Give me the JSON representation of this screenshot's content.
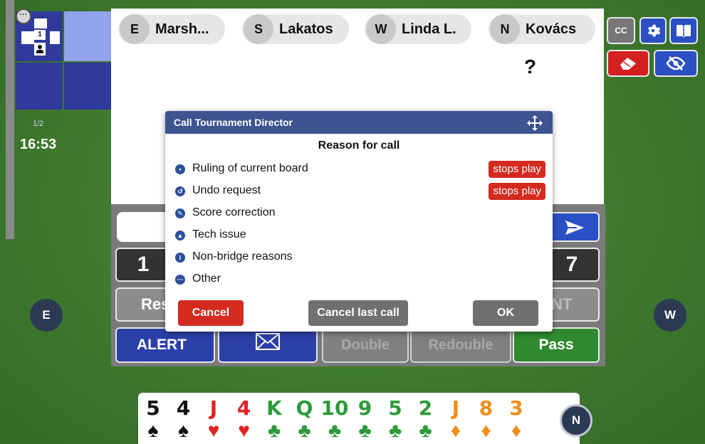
{
  "board_panel": {
    "board_number": "1",
    "round": "1/2",
    "timer": "16:53",
    "chat_icon": "chat-bubble-icon"
  },
  "players": [
    {
      "seat": "E",
      "name": "Marsh..."
    },
    {
      "seat": "S",
      "name": "Lakatos"
    },
    {
      "seat": "W",
      "name": "Linda L."
    },
    {
      "seat": "N",
      "name": "Kovács"
    }
  ],
  "auction_marker": "?",
  "toolbar": {
    "cc_label": "CC",
    "gear_icon": "gear-icon",
    "book_icon": "book-icon",
    "eraser_icon": "eraser-icon",
    "eye_icon": "eye-slash-icon"
  },
  "bidding_box": {
    "send_icon": "send-icon",
    "level_left": "1",
    "level_right": "7",
    "row_left_partial": "Res",
    "row_right_partial": "NT",
    "alert_label": "ALERT",
    "mail_icon": "envelope-icon",
    "double_label": "Double",
    "redouble_label": "Redouble",
    "pass_label": "Pass"
  },
  "side_seats": {
    "left": "E",
    "right": "W",
    "bottom": "N"
  },
  "dialog": {
    "title": "Call Tournament Director",
    "move_icon": "move-arrows-icon",
    "subtitle": "Reason for call",
    "reasons": [
      {
        "label": "Ruling of current board",
        "badge": "stops play",
        "icon": "ruling-icon"
      },
      {
        "label": "Undo request",
        "badge": "stops play",
        "icon": "undo-icon"
      },
      {
        "label": "Score correction",
        "badge": "",
        "icon": "pencil-icon"
      },
      {
        "label": "Tech issue",
        "badge": "",
        "icon": "warning-icon"
      },
      {
        "label": "Non-bridge reasons",
        "badge": "",
        "icon": "info-icon"
      },
      {
        "label": "Other",
        "badge": "",
        "icon": "ellipsis-icon"
      }
    ],
    "cancel_label": "Cancel",
    "cancel_last_label": "Cancel last call",
    "ok_label": "OK"
  },
  "hand": [
    {
      "rank": "5",
      "suit": "♠",
      "color": "#111111"
    },
    {
      "rank": "4",
      "suit": "♠",
      "color": "#111111"
    },
    {
      "rank": "J",
      "suit": "♥",
      "color": "#e02424"
    },
    {
      "rank": "4",
      "suit": "♥",
      "color": "#e02424"
    },
    {
      "rank": "K",
      "suit": "♣",
      "color": "#2e9a3a"
    },
    {
      "rank": "Q",
      "suit": "♣",
      "color": "#2e9a3a"
    },
    {
      "rank": "10",
      "suit": "♣",
      "color": "#2e9a3a"
    },
    {
      "rank": "9",
      "suit": "♣",
      "color": "#2e9a3a"
    },
    {
      "rank": "5",
      "suit": "♣",
      "color": "#2e9a3a"
    },
    {
      "rank": "2",
      "suit": "♣",
      "color": "#2e9a3a"
    },
    {
      "rank": "J",
      "suit": "♦",
      "color": "#f28c1b"
    },
    {
      "rank": "8",
      "suit": "♦",
      "color": "#f28c1b"
    },
    {
      "rank": "3",
      "suit": "♦",
      "color": "#f28c1b"
    }
  ],
  "colors": {
    "felt": "#3f7a2f",
    "accent_blue": "#2b50c4",
    "danger_red": "#d42a1f",
    "dialog_header": "#3d5490"
  }
}
